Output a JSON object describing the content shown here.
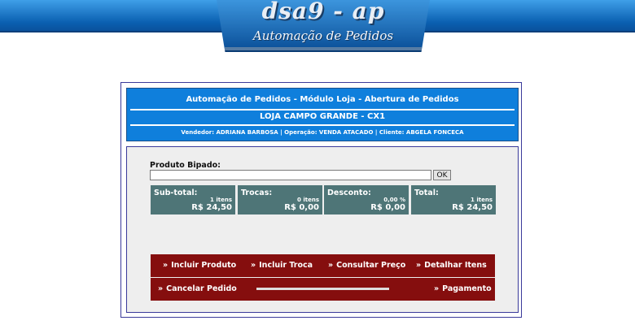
{
  "brand": {
    "logo": "dsa9 - ap",
    "subtitle": "Automação de Pedidos"
  },
  "header": {
    "title": "Automação de Pedidos - Módulo Loja - Abertura de Pedidos",
    "store": "LOJA CAMPO GRANDE - CX1",
    "info": "Vendedor: ADRIANA BARBOSA | Operação: VENDA ATACADO | Cliente: ABGELA FONCECA"
  },
  "product": {
    "label": "Produto Bipado:",
    "value": "",
    "ok_label": "OK"
  },
  "totals": [
    {
      "label": "Sub-total:",
      "count": "1 itens",
      "value": "R$ 24,50"
    },
    {
      "label": "Trocas:",
      "count": "0 itens",
      "value": "R$ 0,00"
    },
    {
      "label": "Desconto:",
      "count": "0,00 %",
      "value": "R$ 0,00"
    },
    {
      "label": "Total:",
      "count": "1 itens",
      "value": "R$ 24,50"
    }
  ],
  "actions": {
    "prefix": "»",
    "incluir_produto": "Incluir Produto",
    "incluir_troca": "Incluir Troca",
    "consultar_preco": "Consultar Preço",
    "detalhar_itens": "Detalhar Itens",
    "cancelar_pedido": "Cancelar Pedido",
    "pagamento": "Pagamento"
  },
  "colors": {
    "header_blue": "#0f7fdc",
    "box_teal": "#4e7577",
    "action_red": "#850e0e",
    "panel_gray": "#eeeeee"
  }
}
